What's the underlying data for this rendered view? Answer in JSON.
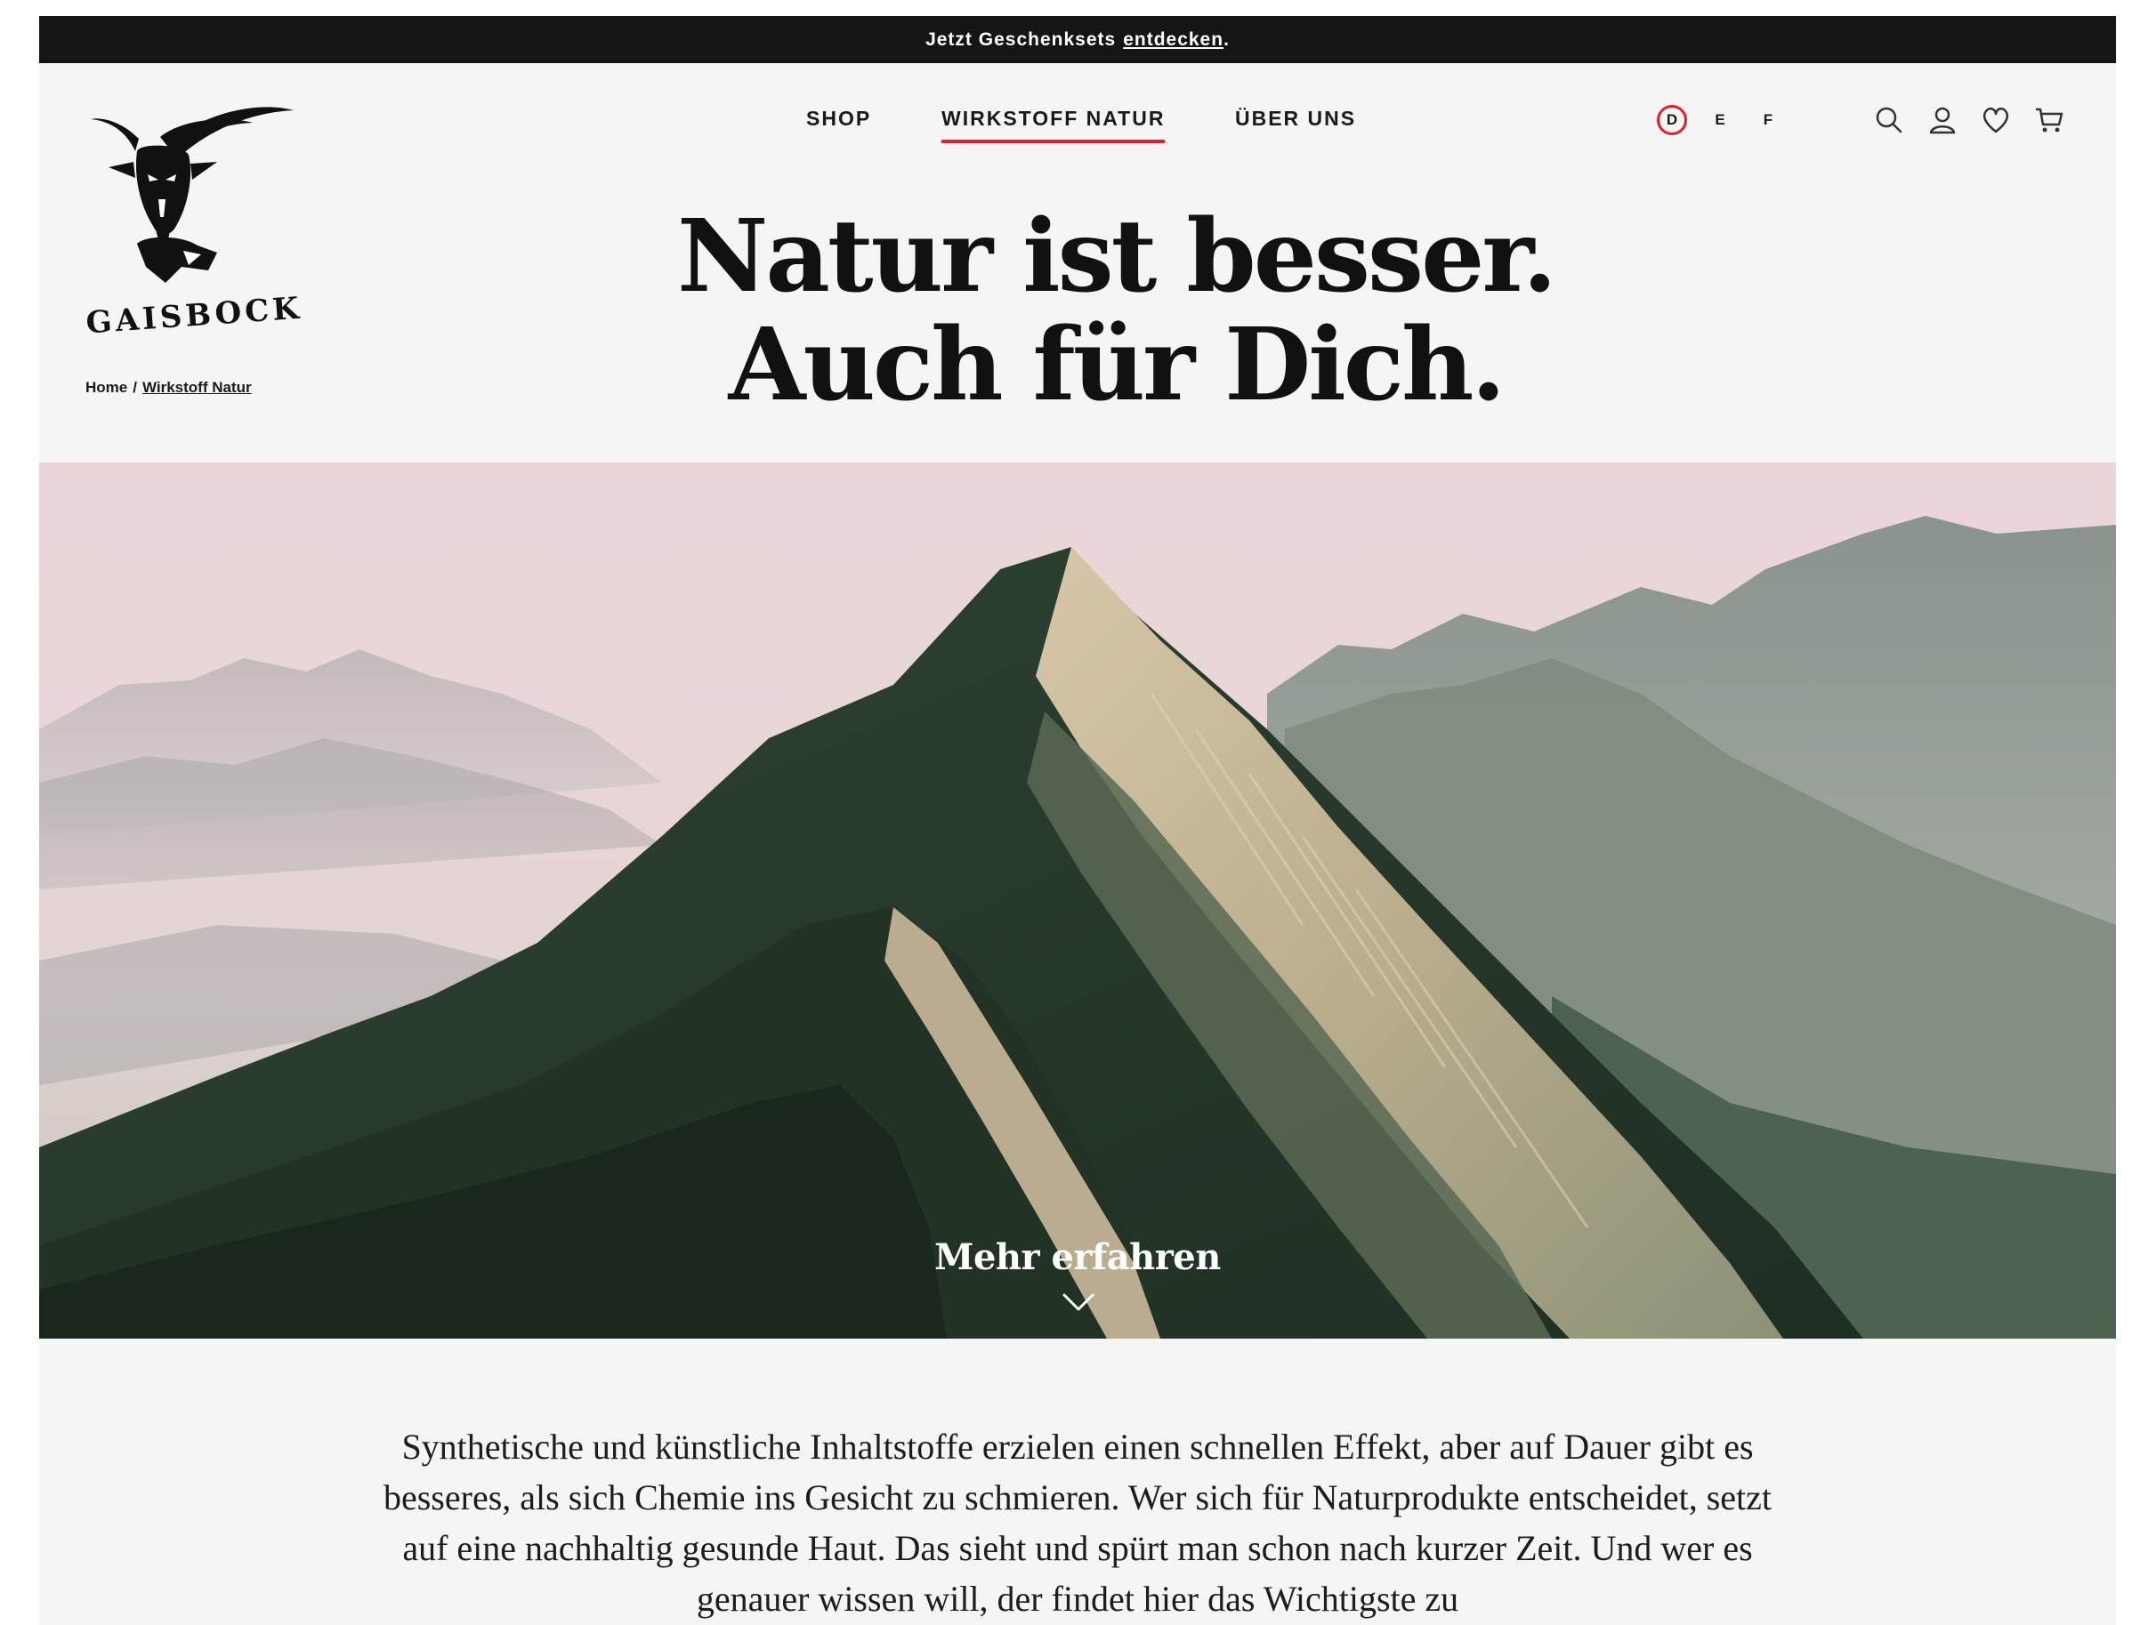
{
  "announcement": {
    "text": "Jetzt Geschenksets",
    "link": "entdecken",
    "suffix": "."
  },
  "brand": {
    "name": "GAISBOCK",
    "logo_icon": "goat-head-logo"
  },
  "nav": {
    "items": [
      {
        "label": "SHOP",
        "active": false
      },
      {
        "label": "WIRKSTOFF NATUR",
        "active": true
      },
      {
        "label": "ÜBER UNS",
        "active": false
      }
    ]
  },
  "languages": {
    "items": [
      {
        "label": "D",
        "active": true
      },
      {
        "label": "E",
        "active": false
      },
      {
        "label": "F",
        "active": false
      }
    ]
  },
  "header_icons": [
    "search-icon",
    "account-icon",
    "wishlist-icon",
    "cart-icon"
  ],
  "breadcrumb": {
    "home": "Home",
    "separator": "/",
    "current": "Wirkstoff Natur"
  },
  "headline": {
    "line1": "Natur ist besser.",
    "line2": "Auch für Dich."
  },
  "hero": {
    "cta": "Mehr erfahren",
    "chevron_icon": "chevron-down-icon"
  },
  "intro": {
    "text": "Synthetische und künstliche Inhaltstoffe erzielen einen schnellen Effekt, aber auf Dauer gibt es besseres, als sich Chemie ins Gesicht zu schmieren. Wer sich für Naturprodukte entscheidet, setzt auf eine nachhaltig gesunde Haut. Das sieht und spürt man schon nach kurzer Zeit. Und wer es genauer wissen will, der findet hier das Wichtigste zu"
  },
  "colors": {
    "accent": "#e0202a",
    "announcement_bg": "#151515",
    "page_bg": "#f5f5f5",
    "text": "#111111"
  }
}
